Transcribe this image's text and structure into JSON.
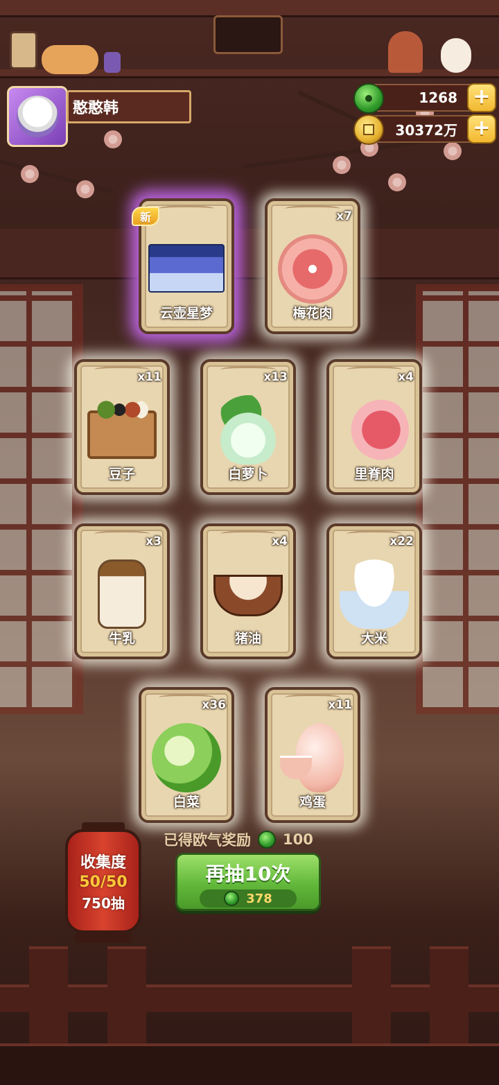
{
  "player": {
    "name": "憨憨韩"
  },
  "currencies": {
    "jade": {
      "amount": "1268",
      "icon": "jade-icon"
    },
    "coins": {
      "amount": "30372万",
      "icon": "coin-icon"
    }
  },
  "cards": [
    {
      "name": "云壶星梦",
      "count": "",
      "badge": "新",
      "rarity": "special",
      "icon": "banner-art-icon"
    },
    {
      "name": "梅花肉",
      "count": "x7",
      "icon": "pork-shoulder-icon"
    },
    {
      "name": "豆子",
      "count": "x11",
      "icon": "beans-box-icon"
    },
    {
      "name": "白萝卜",
      "count": "x13",
      "icon": "white-radish-icon"
    },
    {
      "name": "里脊肉",
      "count": "x4",
      "icon": "tenderloin-icon"
    },
    {
      "name": "牛乳",
      "count": "x3",
      "icon": "milk-jar-icon"
    },
    {
      "name": "猪油",
      "count": "x4",
      "icon": "lard-bowl-icon"
    },
    {
      "name": "大米",
      "count": "x22",
      "icon": "rice-bowl-icon"
    },
    {
      "name": "白菜",
      "count": "x36",
      "icon": "cabbage-icon"
    },
    {
      "name": "鸡蛋",
      "count": "x11",
      "icon": "egg-icon"
    }
  ],
  "bonus": {
    "label": "已得欧气奖励",
    "value": "100"
  },
  "collection": {
    "title": "收集度",
    "progress": "50/50",
    "draws": "750抽"
  },
  "draw_button": {
    "label": "再抽10次",
    "cost": "378"
  },
  "colors": {
    "jade": "#3aa02a",
    "gold": "#ffc83a",
    "card_bg": "#e8d6b0",
    "special_glow": "#ce6eff"
  }
}
